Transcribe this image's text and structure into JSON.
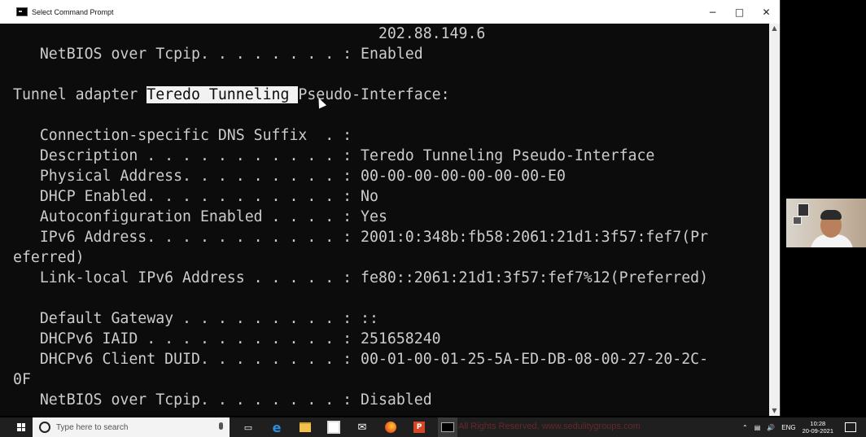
{
  "window": {
    "title": "Select Command Prompt",
    "minimize": "−",
    "maximize": "□",
    "close": "✕"
  },
  "console": {
    "lines": [
      "                                         202.88.149.6",
      "   NetBIOS over Tcpip. . . . . . . . : Enabled",
      "",
      "Tunnel adapter Teredo Tunneling Pseudo-Interface:",
      "",
      "   Connection-specific DNS Suffix  . :",
      "   Description . . . . . . . . . . . : Teredo Tunneling Pseudo-Interface",
      "   Physical Address. . . . . . . . . : 00-00-00-00-00-00-00-E0",
      "   DHCP Enabled. . . . . . . . . . . : No",
      "   Autoconfiguration Enabled . . . . : Yes",
      "   IPv6 Address. . . . . . . . . . . : 2001:0:348b:fb58:2061:21d1:3f57:fef7(Pr",
      "eferred)",
      "   Link-local IPv6 Address . . . . . : fe80::2061:21d1:3f57:fef7%12(Preferred)",
      "",
      "   Default Gateway . . . . . . . . . : ::",
      "   DHCPv6 IAID . . . . . . . . . . . : 251658240",
      "   DHCPv6 Client DUID. . . . . . . . : 00-01-00-01-25-5A-ED-DB-08-00-27-20-2C-",
      "0F",
      "   NetBIOS over Tcpip. . . . . . . . : Disabled"
    ],
    "selection": {
      "prefix": "Tunnel adapter ",
      "selected": "Teredo Tunneling ",
      "suffix": "Pseudo-Interface:"
    }
  },
  "taskbar": {
    "search_placeholder": "Type here to search",
    "background_text": "All Rights Reserved, www.sedulitygroups.com",
    "tray_language": "ENG",
    "clock_time": "10:28",
    "clock_date": "20-09-2021"
  },
  "colors": {
    "console_bg": "#0c0c0c",
    "console_fg": "#cccccc",
    "selection_bg": "#f2f2f2",
    "taskbar_bg": "#1f1f1f"
  }
}
